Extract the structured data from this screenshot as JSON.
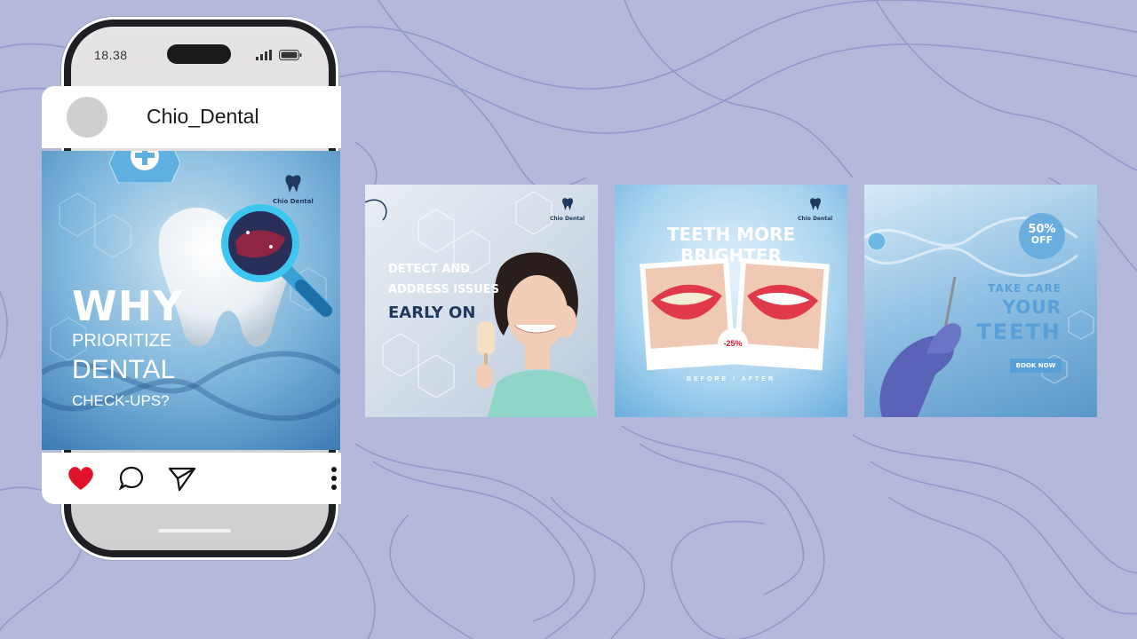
{
  "phone": {
    "status_time": "18.38",
    "icons": [
      "signal-icon",
      "battery-icon"
    ]
  },
  "post": {
    "username": "Chio_Dental",
    "brand": "Chio Dental",
    "headline_why": "WHY",
    "headline_prioritize": "PRIORITIZE",
    "headline_dental": "DENTAL",
    "headline_checkups": "CHECK-UPS?",
    "actions": [
      "heart-icon",
      "comment-icon",
      "send-icon",
      "more-icon"
    ]
  },
  "cards": {
    "card1": {
      "brand": "Chio Dental",
      "line1": "DETECT AND",
      "line2": "ADDRESS ISSUES",
      "line3": "EARLY ON"
    },
    "card2": {
      "brand": "Chio Dental",
      "title": "TEETH MORE BRIGHTER",
      "badge": "-25%",
      "caption": "BEFORE / AFTER"
    },
    "card3": {
      "badge_top": "50%",
      "badge_bottom": "OFF",
      "line1": "TAKE CARE",
      "line2": "YOUR",
      "line3": "TEETH",
      "button": "BOOK NOW"
    }
  },
  "colors": {
    "background": "#b4b9dc",
    "topo_line": "#8d94c8",
    "heart": "#e0132b",
    "navy": "#1f3a5c",
    "accent_blue": "#5aa0d8"
  }
}
